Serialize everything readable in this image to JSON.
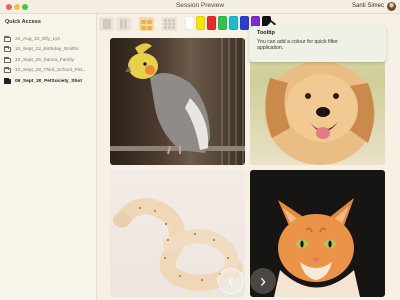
{
  "window": {
    "title": "Session Preview",
    "user_name": "Santi Simec"
  },
  "sidebar": {
    "heading": "Quick Access",
    "items": [
      {
        "label": "22_Aug_22_Elly_Lyn",
        "active": false
      },
      {
        "label": "10_Sept_22_Birthday_Smiths",
        "active": false
      },
      {
        "label": "10_Sept_25_Samia_Family",
        "active": false
      },
      {
        "label": "10_Sept_28_Third_School_Pict...",
        "active": false
      },
      {
        "label": "09_Sept_30_PetSociety_Shot",
        "active": true
      }
    ]
  },
  "toolbar": {
    "layouts": [
      "single-layout-icon",
      "double-layout-icon",
      "grid-2x2-layout-icon",
      "grid-3x3-layout-icon"
    ],
    "selected_layout": "grid-2x2-layout-icon",
    "swatches": [
      "#ffffff",
      "#f7e400",
      "#e62a2a",
      "#2cc44a",
      "#1dbbcf",
      "#2b3dd8",
      "#7a2cd0",
      "#111111"
    ]
  },
  "tooltip": {
    "title": "Tooltip",
    "body": "You can add a colour for quick filter application."
  },
  "photos": [
    {
      "name": "cockatiel-photo"
    },
    {
      "name": "golden-retriever-photo"
    },
    {
      "name": "snake-photo"
    },
    {
      "name": "orange-cat-photo"
    }
  ],
  "navigation": {
    "prev_icon": "‹",
    "next_icon": "›"
  }
}
